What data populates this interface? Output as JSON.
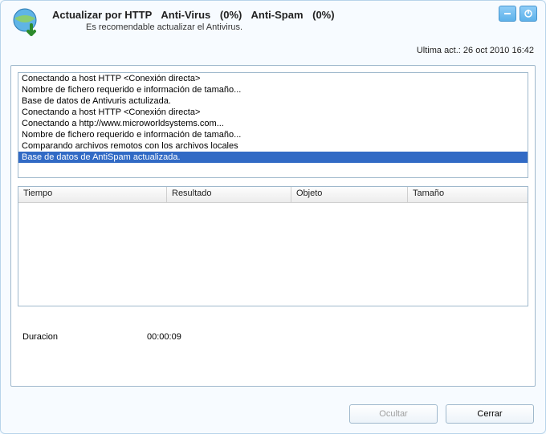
{
  "header": {
    "title_prefix": "Actualizar por HTTP",
    "av_label": "Anti-Virus",
    "av_pct": "(0%)",
    "as_label": "Anti-Spam",
    "as_pct": "(0%)",
    "subtitle": "Es recomendable actualizar el Antivirus.",
    "last_update": "Ultima act.: 26 oct 2010 16:42"
  },
  "log": [
    {
      "text": "Conectando a host HTTP <Conexión directa>",
      "selected": false
    },
    {
      "text": "Nombre de fichero requerido e información de tamaño...",
      "selected": false
    },
    {
      "text": "Base de datos de Antivuris actulizada.",
      "selected": false
    },
    {
      "text": "Conectando a host HTTP <Conexión directa>",
      "selected": false
    },
    {
      "text": "Conectando a http://www.microworldsystems.com...",
      "selected": false
    },
    {
      "text": "Nombre de fichero requerido e información de tamaño...",
      "selected": false
    },
    {
      "text": "Comparando archivos remotos con los archivos locales",
      "selected": false
    },
    {
      "text": "Base de datos de AntiSpam actualizada.",
      "selected": true
    }
  ],
  "table": {
    "headers": {
      "time": "Tiempo",
      "result": "Resultado",
      "object": "Objeto",
      "size": "Tamaño"
    }
  },
  "duration": {
    "label": "Duracion",
    "value": "00:00:09"
  },
  "buttons": {
    "hide": "Ocultar",
    "close": "Cerrar"
  }
}
